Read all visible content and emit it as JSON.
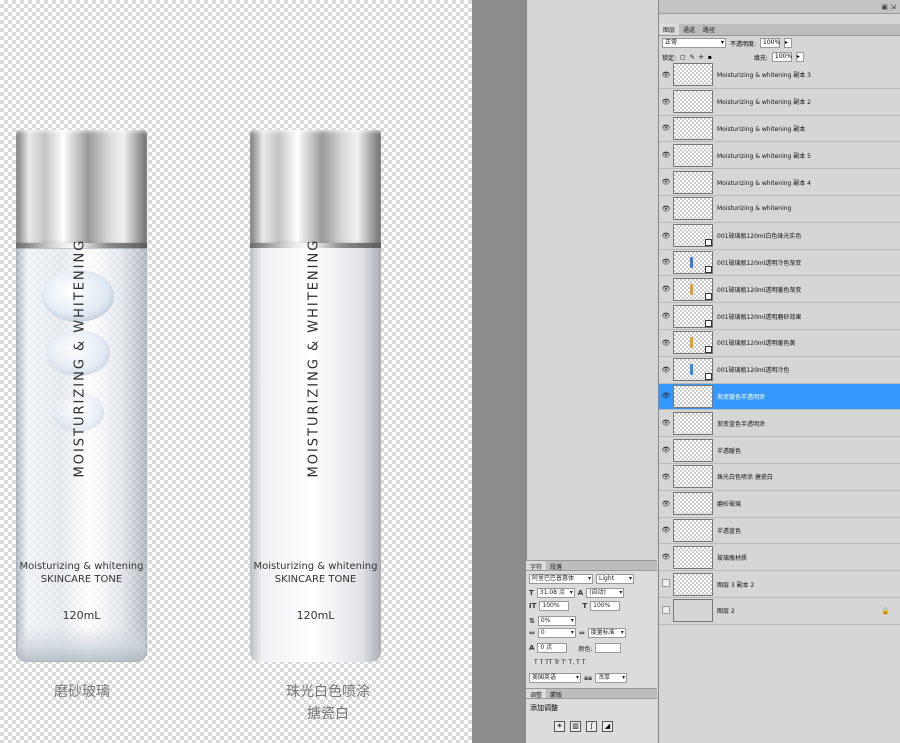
{
  "canvas": {
    "left_bottle": {
      "vertical_text": "MOISTURIZING & WHITENING",
      "label_line1": "Moisturizing & whitening",
      "label_line2": "SKINCARE TONE",
      "volume": "120mL",
      "caption_line1": "磨砂玻璃"
    },
    "right_bottle": {
      "vertical_text": "MOISTURIZING & WHITENING",
      "label_line1": "Moisturizing & whitening",
      "label_line2": "SKINCARE TONE",
      "volume": "120mL",
      "caption_line1": "珠光白色喷涂",
      "caption_line2": "搪瓷白"
    }
  },
  "layers_panel": {
    "tabs": [
      "图层",
      "通道",
      "路径"
    ],
    "blend_mode": "正常",
    "opacity_label": "不透明度:",
    "opacity_value": "100%",
    "lock_label": "锁定:",
    "fill_label": "填充:",
    "fill_value": "100%",
    "layers": [
      {
        "name": "Moisturizing & whitening 副本 3",
        "visible": true,
        "smart": false,
        "selected": false
      },
      {
        "name": "Moisturizing & whitening 副本 2",
        "visible": true,
        "smart": false,
        "selected": false
      },
      {
        "name": "Moisturizing & whitening 副本",
        "visible": true,
        "smart": false,
        "selected": false
      },
      {
        "name": "Moisturizing & whitening 副本 5",
        "visible": true,
        "smart": false,
        "selected": false
      },
      {
        "name": "Moisturizing & whitening 副本 4",
        "visible": true,
        "smart": false,
        "selected": false
      },
      {
        "name": "Moisturizing & whitening",
        "visible": true,
        "smart": false,
        "selected": false
      },
      {
        "name": "001玻璃瓶120ml白色珠光实色",
        "visible": true,
        "smart": true,
        "selected": false
      },
      {
        "name": "001玻璃瓶120ml透明冷色渐变",
        "visible": true,
        "smart": true,
        "selected": false,
        "mark_color": "#3a78d6"
      },
      {
        "name": "001玻璃瓶120ml透明暖色渐变",
        "visible": true,
        "smart": true,
        "selected": false,
        "mark_color": "#d9a030"
      },
      {
        "name": "001玻璃瓶120ml透明磨砂效果",
        "visible": true,
        "smart": true,
        "selected": false
      },
      {
        "name": "001玻璃瓶120ml透明暖色黄",
        "visible": true,
        "smart": true,
        "selected": false,
        "mark_color": "#e0a020"
      },
      {
        "name": "001玻璃瓶120ml透明冷色",
        "visible": true,
        "smart": true,
        "selected": false,
        "mark_color": "#2f8ae0"
      },
      {
        "name": "渐变暖色半透明涂",
        "visible": true,
        "smart": false,
        "selected": true
      },
      {
        "name": "渐变蓝色半透明涂",
        "visible": true,
        "smart": false,
        "selected": false
      },
      {
        "name": "半透暖色",
        "visible": true,
        "smart": false,
        "selected": false
      },
      {
        "name": "珠光白色喷涂 搪瓷白",
        "visible": true,
        "smart": false,
        "selected": false
      },
      {
        "name": "磨砂玻璃",
        "visible": true,
        "smart": false,
        "selected": false
      },
      {
        "name": "半透蓝色",
        "visible": true,
        "smart": false,
        "selected": false
      },
      {
        "name": "玻璃瓶材质",
        "visible": true,
        "smart": false,
        "selected": false
      },
      {
        "name": "图层 3 副本 2",
        "visible": false,
        "smart": false,
        "selected": false
      },
      {
        "name": "图层 2",
        "visible": false,
        "smart": false,
        "selected": false,
        "locked": true,
        "plain": true
      }
    ]
  },
  "character_panel": {
    "tabs": [
      "字符",
      "段落"
    ],
    "font_family": "阿里巴巴普惠体",
    "font_style": "Light",
    "font_size": "31.08 点",
    "leading": "(自动)",
    "vertical_scale": "100%",
    "horizontal_scale": "100%",
    "baseline_shift_pct": "0%",
    "tracking": "0",
    "kerning_label": "度量标准",
    "baseline": "0 点",
    "color_label": "颜色:",
    "style_buttons": "T T TT Tr T' T, T T",
    "language": "美国英语",
    "antialias_icon": "aa",
    "antialias": "浑厚"
  },
  "adjustments_panel": {
    "tabs": [
      "调整",
      "蒙版"
    ],
    "title": "添加调整"
  },
  "colors": {
    "selection": "#3399ff",
    "panel_bg": "#d6d6d6"
  }
}
